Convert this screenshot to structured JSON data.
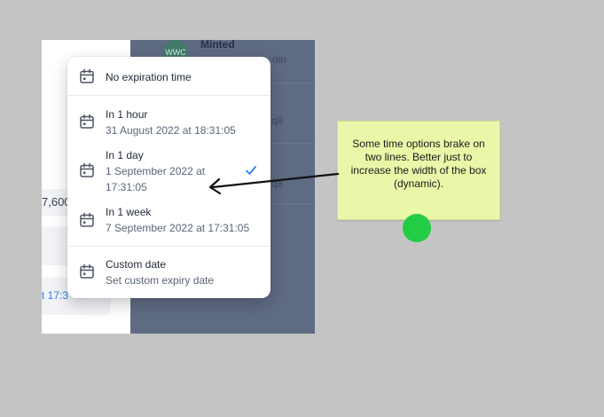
{
  "background_left": {
    "field_values": [
      "7,600",
      "t 17:3"
    ]
  },
  "background_right": {
    "avatar_text": "WWC",
    "row_title": "Minted",
    "row_fragments": [
      "oin",
      "q8",
      "q8"
    ]
  },
  "dropdown": {
    "items": [
      {
        "title": "No expiration time",
        "subtitle": "",
        "icon": "calendar-icon"
      },
      {
        "title": "In 1 hour",
        "subtitle": "31 August 2022 at 18:31:05",
        "icon": "calendar-icon"
      },
      {
        "title": "In 1 day",
        "subtitle": "1 September 2022 at 17:31:05",
        "icon": "calendar-icon",
        "selected": true
      },
      {
        "title": "In 1 week",
        "subtitle": "7 September 2022 at 17:31:05",
        "icon": "calendar-icon"
      },
      {
        "title": "Custom date",
        "subtitle": "Set custom expiry date",
        "icon": "calendar-icon"
      }
    ],
    "check_icon": "check-icon",
    "accent_color": "#2f80ed"
  },
  "annotation": {
    "note_text": "Some time options brake on two lines. Better just to increase the width of the box (dynamic).",
    "note_color": "#e9f7a8",
    "dot_color": "#22cc44"
  }
}
